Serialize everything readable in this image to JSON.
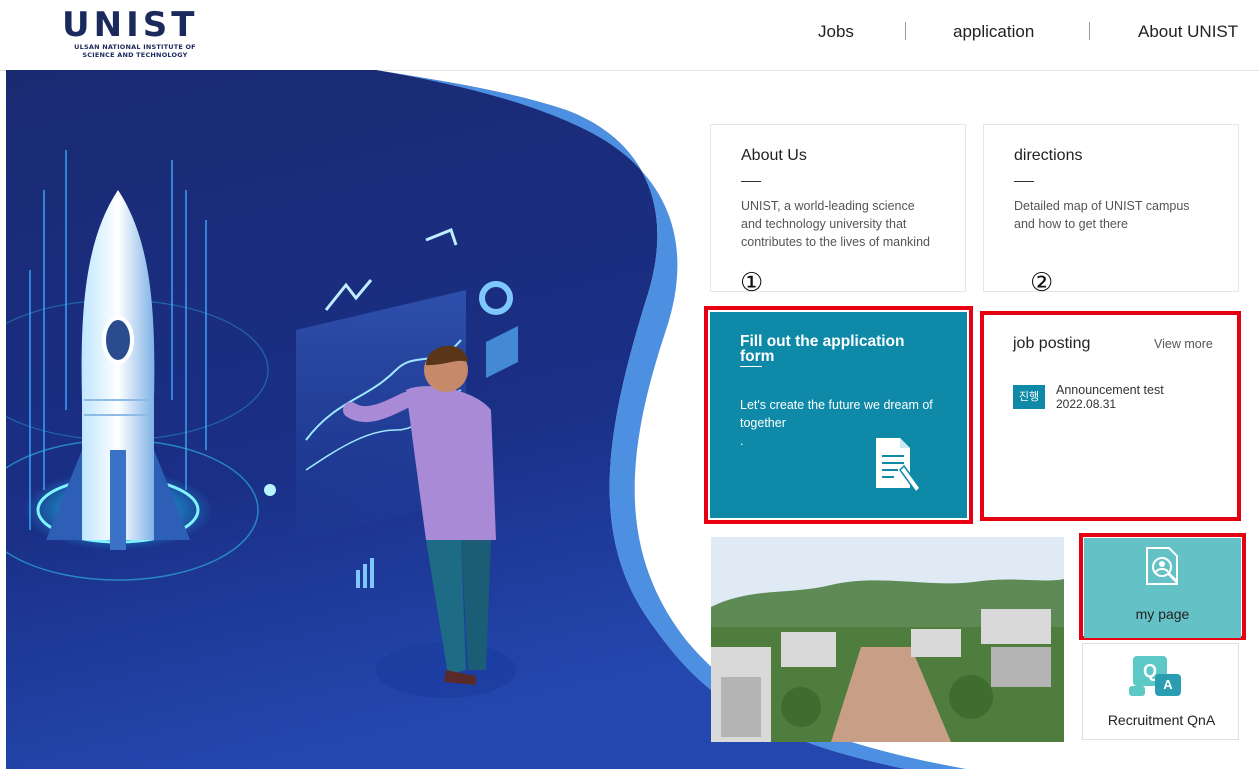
{
  "header": {
    "logo_text": "UNIST",
    "logo_subtitle": "ULSAN NATIONAL INSTITUTE OF SCIENCE AND TECHNOLOGY",
    "nav": [
      {
        "label": "Jobs"
      },
      {
        "label": "application"
      },
      {
        "label": "About UNIST"
      }
    ]
  },
  "cards": {
    "about": {
      "title": "About Us",
      "description": "UNIST, a world-leading science and technology university that contributes to the lives of mankind"
    },
    "directions": {
      "title": "directions",
      "description": "Detailed map of UNIST campus and how to get there"
    },
    "apply": {
      "title": "Fill out the application form",
      "description": "Let's create the future we dream of together",
      "dot": "."
    },
    "job_posting": {
      "title": "job posting",
      "view_more": "View more",
      "items": [
        {
          "badge": "진행",
          "title": "Announcement test",
          "date": "2022.08.31"
        }
      ]
    },
    "mypage": {
      "label": "my page"
    },
    "qna": {
      "label": "Recruitment QnA",
      "icon_q": "Q",
      "icon_a": "A"
    }
  },
  "annotations": {
    "marker_1": "①",
    "marker_2": "②"
  },
  "colors": {
    "apply_bg": "#0e8aa8",
    "mypage_bg": "#64c2c6",
    "highlight_red": "#e60012",
    "hero_dark": "#16216a",
    "badge_bg": "#0e8aa8"
  },
  "icons": [
    "document-edit-icon",
    "user-search-icon",
    "qna-chat-icon",
    "rocket-illustration"
  ]
}
